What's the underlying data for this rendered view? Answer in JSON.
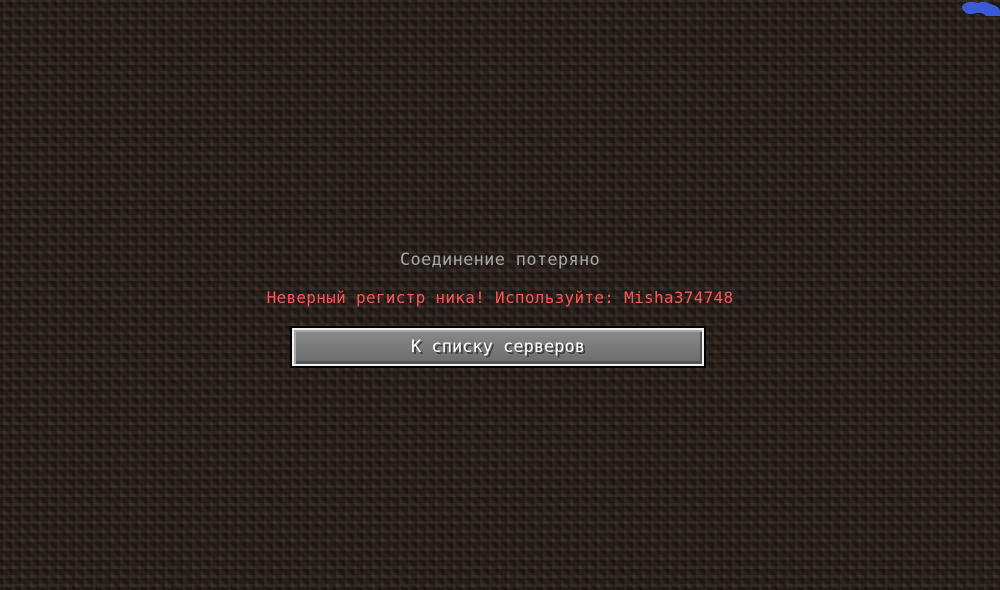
{
  "screen": {
    "title": "Соединение потеряно",
    "reason": "Неверный регистр ника! Используйте: Misha374748",
    "back_button_label": "К списку серверов"
  },
  "colors": {
    "title": "#a8a8a8",
    "reason": "#ff5555",
    "button_text": "#ffffff",
    "corner_icon": "#3b5bd6"
  },
  "icons": {
    "corner": "blue-blob-icon"
  }
}
